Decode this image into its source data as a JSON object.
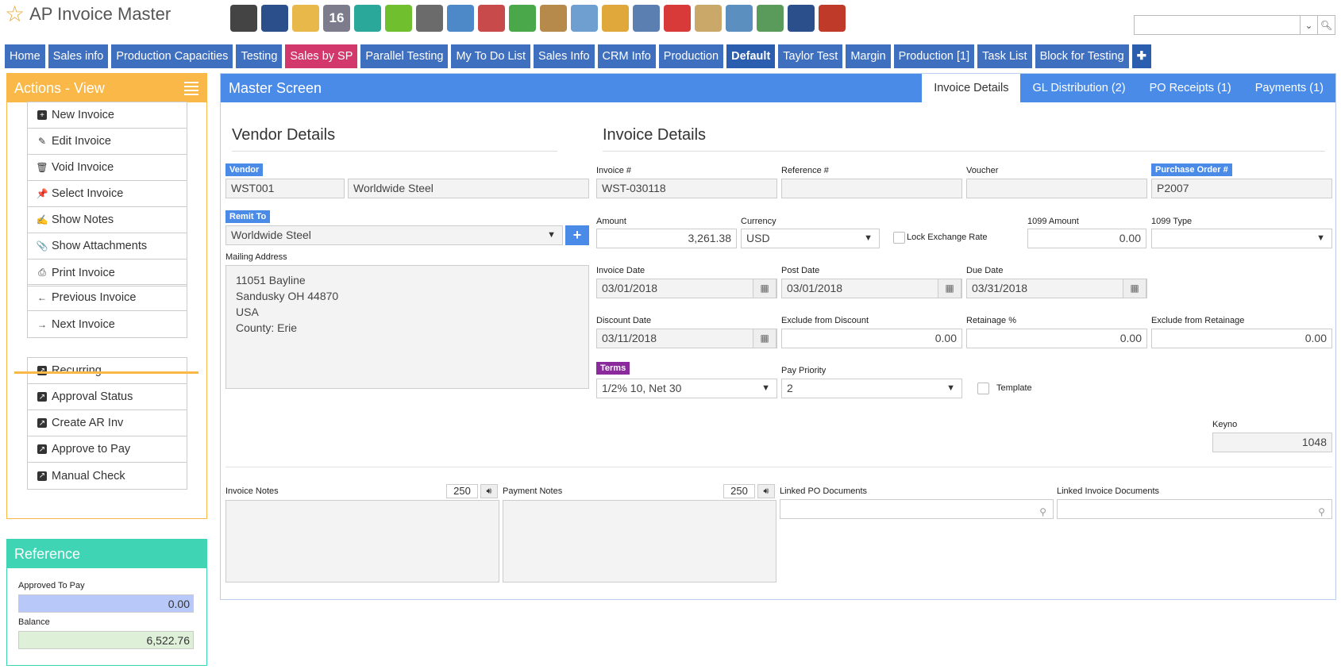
{
  "app": {
    "title": "AP Invoice Master"
  },
  "toolbar": {
    "icons": [
      {
        "name": "bank-icon",
        "color": "#444"
      },
      {
        "name": "user-icon",
        "color": "#2a4f8a"
      },
      {
        "name": "weather-icon",
        "color": "#e9b84a"
      },
      {
        "name": "calendar-icon",
        "color": "#7c7c8c",
        "text": "16"
      },
      {
        "name": "clock-icon",
        "color": "#2aa89a"
      },
      {
        "name": "checkmark-icon",
        "color": "#6fbf2f"
      },
      {
        "name": "keyboard-icon",
        "color": "#6b6b6b"
      },
      {
        "name": "magnifier-icon",
        "color": "#4d88c9"
      },
      {
        "name": "truck-icon",
        "color": "#c94a4a"
      },
      {
        "name": "basket-icon",
        "color": "#4aa84a"
      },
      {
        "name": "box-in-icon",
        "color": "#b58a4a"
      },
      {
        "name": "box-out-icon",
        "color": "#6f9fd0"
      },
      {
        "name": "coins-icon",
        "color": "#e0a83a"
      },
      {
        "name": "monitor-icon",
        "color": "#5a7fb0"
      },
      {
        "name": "dollar-chat-icon",
        "color": "#d83a3a"
      },
      {
        "name": "clipboard-icon",
        "color": "#c9a86a"
      },
      {
        "name": "pencil-icon",
        "color": "#5a8fc0"
      },
      {
        "name": "money-icon",
        "color": "#5a9a5a"
      },
      {
        "name": "calculator-icon",
        "color": "#2a4f8a"
      },
      {
        "name": "factory-icon",
        "color": "#c03a2a"
      }
    ]
  },
  "search": {
    "placeholder": ""
  },
  "nav": {
    "tabs": [
      {
        "label": "Home",
        "style": ""
      },
      {
        "label": "Sales info",
        "style": ""
      },
      {
        "label": "Production Capacities",
        "style": ""
      },
      {
        "label": "Testing",
        "style": ""
      },
      {
        "label": "Sales by SP",
        "style": "pink"
      },
      {
        "label": "Parallel Testing",
        "style": ""
      },
      {
        "label": "My To Do List",
        "style": ""
      },
      {
        "label": "Sales Info",
        "style": ""
      },
      {
        "label": "CRM Info",
        "style": ""
      },
      {
        "label": "Production",
        "style": ""
      },
      {
        "label": "Default",
        "style": "bold"
      },
      {
        "label": "Taylor Test",
        "style": ""
      },
      {
        "label": "Margin",
        "style": ""
      },
      {
        "label": "Production [1]",
        "style": ""
      },
      {
        "label": "Task List",
        "style": ""
      },
      {
        "label": "Block for Testing",
        "style": ""
      },
      {
        "label": "✚",
        "style": "bold"
      }
    ]
  },
  "actions": {
    "title": "Actions - View",
    "group1": [
      {
        "label": "New Invoice",
        "icon": "plus-square-icon",
        "glyph": "+"
      },
      {
        "label": "Edit Invoice",
        "icon": "pencil-icon",
        "glyph": "✎"
      },
      {
        "label": "Void Invoice",
        "icon": "trash-icon",
        "glyph": "🗑"
      },
      {
        "label": "Select Invoice",
        "icon": "pin-icon",
        "glyph": "📌"
      },
      {
        "label": "Show Notes",
        "icon": "edit-note-icon",
        "glyph": "✍"
      },
      {
        "label": "Show Attachments",
        "icon": "paperclip-icon",
        "glyph": "📎"
      },
      {
        "label": "Print Invoice",
        "icon": "printer-icon",
        "glyph": "⎙"
      }
    ],
    "group2": [
      {
        "label": "Previous Invoice",
        "icon": "arrow-left-icon",
        "glyph": "←"
      },
      {
        "label": "Next Invoice",
        "icon": "arrow-right-icon",
        "glyph": "→"
      }
    ],
    "group3": [
      {
        "label": "Recurring",
        "icon": "external-link-icon",
        "glyph": "↗"
      },
      {
        "label": "Approval Status",
        "icon": "external-link-icon",
        "glyph": "↗"
      },
      {
        "label": "Create AR Inv",
        "icon": "external-link-icon",
        "glyph": "↗"
      },
      {
        "label": "Approve to Pay",
        "icon": "external-link-icon",
        "glyph": "↗"
      },
      {
        "label": "Manual Check",
        "icon": "external-link-icon",
        "glyph": "↗"
      }
    ]
  },
  "reference": {
    "title": "Reference",
    "approved_label": "Approved To Pay",
    "approved_value": "0.00",
    "approved_color": "#b8c8f8",
    "balance_label": "Balance",
    "balance_value": "6,522.76",
    "balance_color": "#dff0d8"
  },
  "main": {
    "title": "Master Screen",
    "tabs": [
      {
        "label": "Invoice Details",
        "active": true
      },
      {
        "label": "GL Distribution (2)",
        "active": false
      },
      {
        "label": "PO Receipts (1)",
        "active": false
      },
      {
        "label": "Payments (1)",
        "active": false
      }
    ]
  },
  "vendor": {
    "section_title": "Vendor Details",
    "vendor_label": "Vendor",
    "vendor_code": "WST001",
    "vendor_name": "Worldwide Steel",
    "remit_label": "Remit To",
    "remit_value": "Worldwide Steel",
    "mailing_label": "Mailing Address",
    "address": [
      "11051 Bayline",
      "Sandusky OH  44870",
      "USA",
      "County: Erie"
    ]
  },
  "invoice": {
    "section_title": "Invoice Details",
    "invoice_no_label": "Invoice #",
    "invoice_no": "WST-030118",
    "reference_label": "Reference #",
    "reference_value": "",
    "voucher_label": "Voucher",
    "voucher_value": "",
    "po_label": "Purchase Order #",
    "po_value": "P2007",
    "amount_label": "Amount",
    "amount_value": "3,261.38",
    "currency_label": "Currency",
    "currency_value": "USD",
    "lock_label": "Lock Exchange Rate",
    "amt1099_label": "1099 Amount",
    "amt1099_value": "0.00",
    "type1099_label": "1099 Type",
    "type1099_value": "",
    "invoice_date_label": "Invoice Date",
    "invoice_date": "03/01/2018",
    "post_date_label": "Post Date",
    "post_date": "03/01/2018",
    "due_date_label": "Due Date",
    "due_date": "03/31/2018",
    "discount_date_label": "Discount Date",
    "discount_date": "03/11/2018",
    "excl_discount_label": "Exclude from Discount",
    "excl_discount_value": "0.00",
    "retainage_label": "Retainage %",
    "retainage_value": "0.00",
    "excl_retainage_label": "Exclude from Retainage",
    "excl_retainage_value": "0.00",
    "terms_label": "Terms",
    "terms_value": "1/2% 10, Net 30",
    "pay_priority_label": "Pay Priority",
    "pay_priority_value": "2",
    "template_label": "Template",
    "keyno_label": "Keyno",
    "keyno_value": "1048"
  },
  "notes": {
    "invoice_notes_label": "Invoice Notes",
    "invoice_notes_count": "250",
    "payment_notes_label": "Payment Notes",
    "payment_notes_count": "250",
    "linked_po_label": "Linked PO Documents",
    "linked_inv_label": "Linked Invoice Documents"
  }
}
